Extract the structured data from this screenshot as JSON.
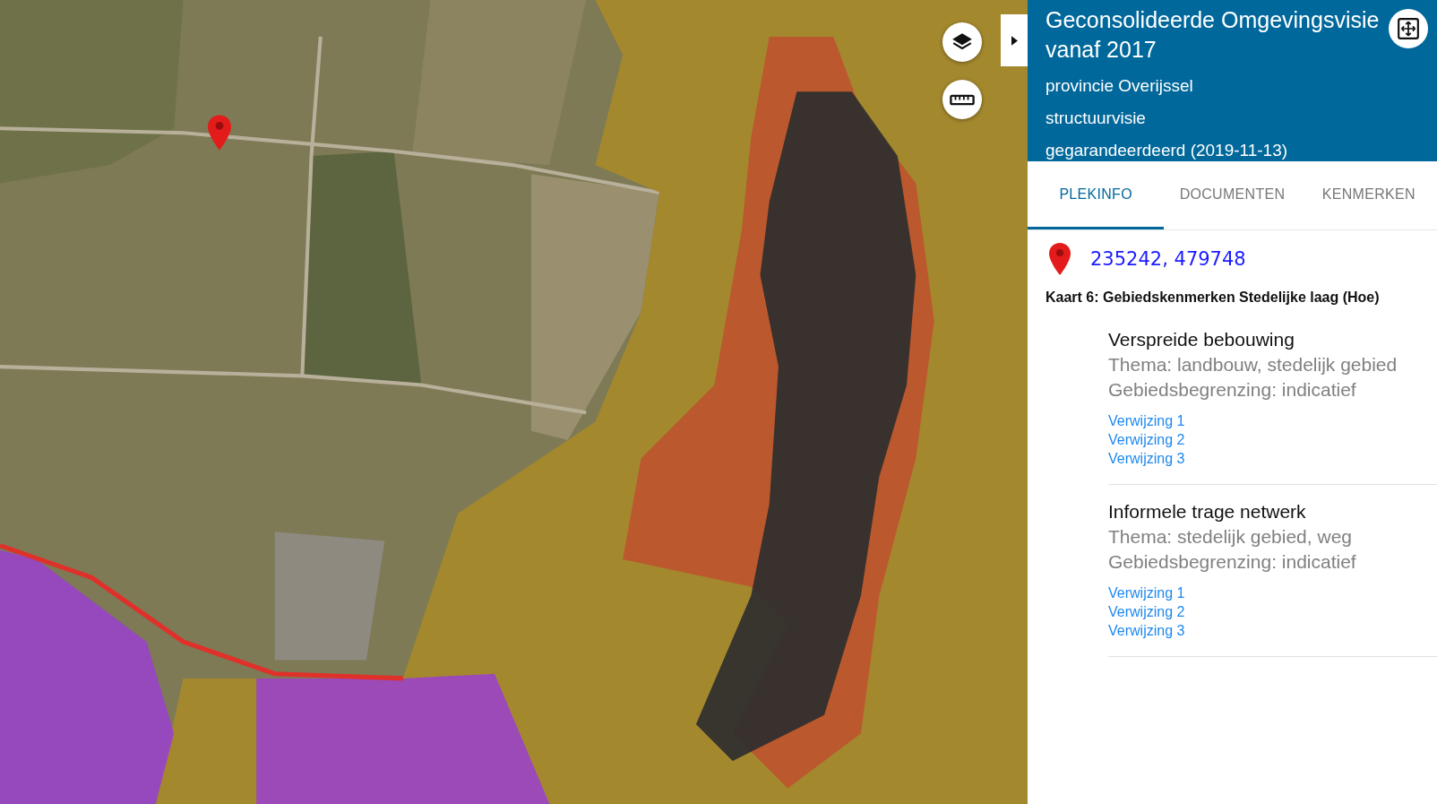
{
  "panel": {
    "title": "Geconsolideerde Omgevingsvisie vanaf 2017",
    "subtitles": [
      "provincie Overijssel",
      "structuurvisie",
      "gegarandeerdeerd (2019-11-13)"
    ],
    "tabs": [
      {
        "label": "PLEKINFO",
        "selected": true
      },
      {
        "label": "DOCUMENTEN",
        "selected": false
      },
      {
        "label": "KENMERKEN",
        "selected": false
      }
    ],
    "location": {
      "coordinates": "235242, 479748"
    },
    "map_title": "Kaart 6: Gebiedskenmerken Stedelijke laag (Hoe)",
    "features": [
      {
        "name": "Verspreide bebouwing",
        "theme": "Thema: landbouw, stedelijk gebied",
        "boundary": "Gebiedsbegrenzing: indicatief",
        "references": [
          "Verwijzing 1",
          "Verwijzing 2",
          "Verwijzing 3"
        ]
      },
      {
        "name": "Informele trage netwerk",
        "theme": "Thema: stedelijk gebied, weg",
        "boundary": "Gebiedsbegrenzing: indicatief",
        "references": [
          "Verwijzing 1",
          "Verwijzing 2",
          "Verwijzing 3"
        ]
      }
    ]
  }
}
